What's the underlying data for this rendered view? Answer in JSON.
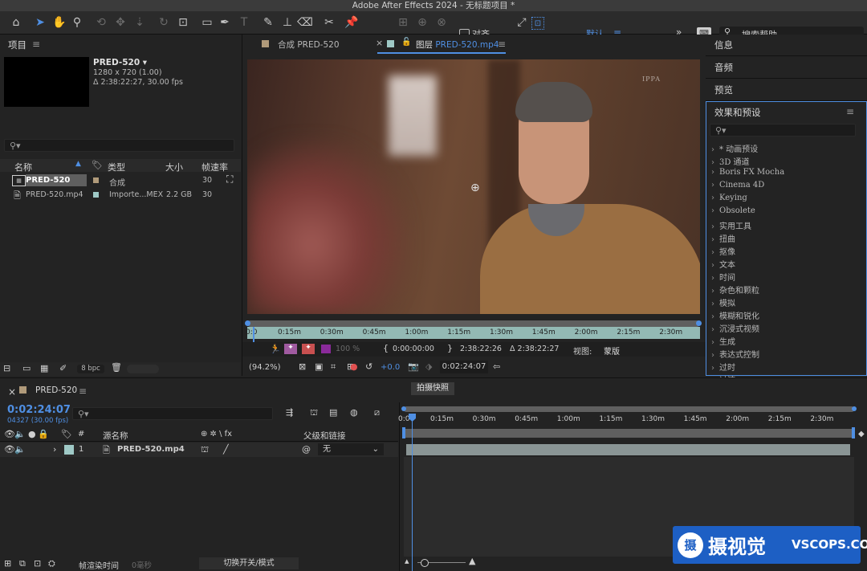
{
  "window": {
    "title": "Adobe After Effects 2024 - 无标题项目 *"
  },
  "toolbar": {
    "snap_label": "对齐",
    "workspace": "默认",
    "search_help": "搜索帮助"
  },
  "project": {
    "title": "项目",
    "comp_name": "PRED-520",
    "comp_dims": "1280 x 720 (1.00)",
    "comp_duration": "Δ 2:38:22:27, 30.00 fps",
    "columns": {
      "name": "名称",
      "type": "类型",
      "size": "大小",
      "fps": "帧速率"
    },
    "rows": [
      {
        "name": "PRED-520",
        "type": "合成",
        "size": "",
        "fps": "30",
        "color": "#b09a7a"
      },
      {
        "name": "PRED-520.mp4",
        "type": "Importe...MEX",
        "size": "2.2 GB",
        "fps": "30",
        "color": "#9fc9c6"
      }
    ],
    "bpc": "8 bpc"
  },
  "viewer": {
    "tab_comp": "合成 PRED-520",
    "tab_layer_prefix": "图层",
    "tab_layer_name": "PRED-520.mp4",
    "watermark": "IPPA",
    "ruler_labels": [
      "0:15m",
      "0:30m",
      "0:45m",
      "1:00m",
      "1:15m",
      "1:30m",
      "1:45m",
      "2:00m",
      "2:15m",
      "2:30m"
    ],
    "ruler_start": "0:0",
    "in_time": "0:00:00:00",
    "out_time": "2:38:22:26",
    "duration": "Δ 2:38:22:27",
    "view_label": "视图:",
    "view_value": "蒙版",
    "opacity": "100 %",
    "zoom": "(94.2%)",
    "exposure": "+0.0",
    "current_time": "0:02:24:07"
  },
  "right_panels": {
    "info": "信息",
    "audio": "音频",
    "preview": "预览",
    "effects_title": "效果和预设",
    "effects": [
      "* 动画预设",
      "3D 通道",
      "Boris FX Mocha",
      "Cinema 4D",
      "Keying",
      "Obsolete",
      "实用工具",
      "扭曲",
      "抠像",
      "文本",
      "时间",
      "杂色和颗粒",
      "模拟",
      "模糊和锐化",
      "沉浸式视频",
      "生成",
      "表达式控制",
      "过时",
      "过渡"
    ]
  },
  "timeline": {
    "comp_name": "PRED-520",
    "timecode": "0:02:24:07",
    "frames": "04327 (30.00 fps)",
    "snapshot_tooltip": "拍摄快照",
    "col_hash": "#",
    "col_source": "源名称",
    "col_switch": "⊕ ✲ \\ fx",
    "col_parent": "父级和链接",
    "layer_index": "1",
    "layer_name": "PRED-520.mp4",
    "parent_value": "无",
    "ruler_labels": [
      "0:15m",
      "0:30m",
      "0:45m",
      "1:00m",
      "1:15m",
      "1:30m",
      "1:45m",
      "2:00m",
      "2:15m",
      "2:30m"
    ],
    "ruler_start": "0:0",
    "render_time_label": "帧渲染时间",
    "render_time_value": "0毫秒",
    "toggle_mode": "切换开关/模式"
  },
  "brand": {
    "name": "摄视觉",
    "site": "VSCOPS.COM"
  },
  "colors": {
    "accent": "#4f8fe3",
    "panel": "#232323",
    "track": "#93b9b4",
    "layer_bar": "#8a9595"
  }
}
